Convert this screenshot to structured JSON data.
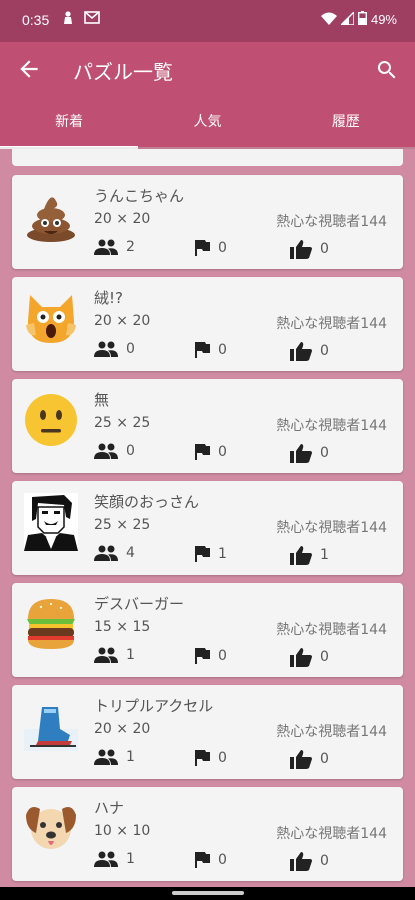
{
  "status_bar": {
    "time": "0:35",
    "battery": "49%"
  },
  "app_bar": {
    "title": "パズル一覧"
  },
  "tabs": [
    {
      "label": "新着",
      "active": true
    },
    {
      "label": "人気",
      "active": false
    },
    {
      "label": "履歴",
      "active": false
    }
  ],
  "puzzles": [
    {
      "name": "うんこちゃん",
      "size": "20 × 20",
      "author": "熱心な視聴者144",
      "players": "2",
      "flags": "0",
      "likes": "0",
      "thumbnail": "poop-emoji"
    },
    {
      "name": "絨!?",
      "size": "20 × 20",
      "author": "熱心な視聴者144",
      "players": "0",
      "flags": "0",
      "likes": "0",
      "thumbnail": "scared-cat-emoji"
    },
    {
      "name": "無",
      "size": "25 × 25",
      "author": "熱心な視聴者144",
      "players": "0",
      "flags": "0",
      "likes": "0",
      "thumbnail": "neutral-face-emoji"
    },
    {
      "name": "笑顔のおっさん",
      "size": "25 × 25",
      "author": "熱心な視聴者144",
      "players": "4",
      "flags": "1",
      "likes": "1",
      "thumbnail": "pixel-man-portrait"
    },
    {
      "name": "デスバーガー",
      "size": "15 × 15",
      "author": "熱心な視聴者144",
      "players": "1",
      "flags": "0",
      "likes": "0",
      "thumbnail": "hamburger-emoji"
    },
    {
      "name": "トリプルアクセル",
      "size": "20 × 20",
      "author": "熱心な視聴者144",
      "players": "1",
      "flags": "0",
      "likes": "0",
      "thumbnail": "skate-boot-emoji"
    },
    {
      "name": "ハナ",
      "size": "10 × 10",
      "author": "熱心な視聴者144",
      "players": "1",
      "flags": "0",
      "likes": "0",
      "thumbnail": "dog-face-emoji"
    }
  ],
  "colors": {
    "status_bar": "#9e3f61",
    "app_bar": "#bf4f73",
    "background": "#d08ba3",
    "card": "#f4f4f4"
  }
}
